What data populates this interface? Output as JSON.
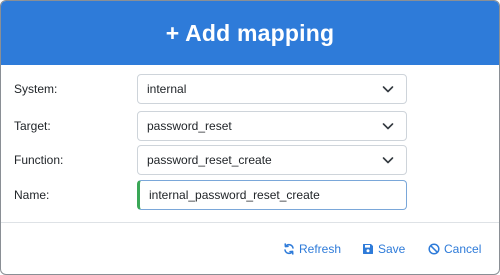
{
  "dialog": {
    "title": "+ Add mapping"
  },
  "form": {
    "system": {
      "label": "System:",
      "value": "internal"
    },
    "target": {
      "label": "Target:",
      "value": "password_reset"
    },
    "function": {
      "label": "Function:",
      "value": "password_reset_create"
    },
    "name": {
      "label": "Name:",
      "value": "internal_password_reset_create"
    }
  },
  "footer": {
    "refresh_label": "Refresh",
    "save_label": "Save",
    "cancel_label": "Cancel"
  },
  "icons": {
    "chevron": "chevron-down-icon",
    "refresh": "refresh-icon",
    "save": "floppy-disk-icon",
    "cancel": "ban-icon"
  },
  "colors": {
    "header": "#2e7bd9",
    "link": "#2e7bd9",
    "valid_indicator": "#3aa757"
  }
}
